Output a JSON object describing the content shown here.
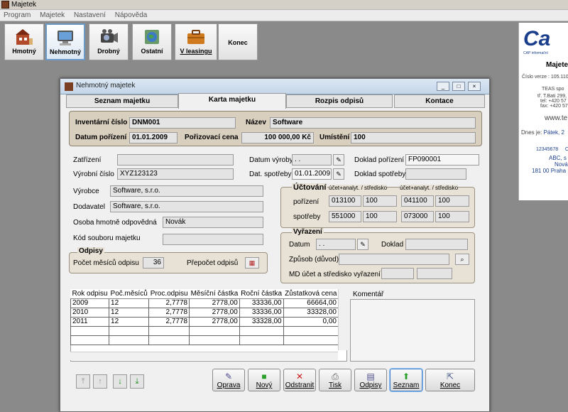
{
  "app": {
    "title": "Majetek"
  },
  "menu": [
    "Program",
    "Majetek",
    "Nastavení",
    "Nápověda"
  ],
  "toolbar": {
    "buttons": [
      {
        "label": "Hmotný",
        "icon": "building-icon"
      },
      {
        "label": "Nehmotný",
        "icon": "monitor-icon"
      },
      {
        "label": "Drobný",
        "icon": "camera-icon"
      },
      {
        "label": "Ostatní",
        "icon": "globe-icon"
      },
      {
        "label": "V leasingu",
        "icon": "briefcase-icon"
      },
      {
        "label": "Konec",
        "icon": ""
      }
    ]
  },
  "sidepanel": {
    "logo": "Ca",
    "logo_sub": "CAP informační",
    "title": "Majetek",
    "version": "Číslo verze : 105.110",
    "company": "TEAS spo",
    "address": "tř. T.Bati 299,",
    "tel": "tel: +420 57",
    "fax": "fax: +420 57",
    "web": "www.te",
    "date_label": "Dnes je:",
    "date_value": "Pátek, 2",
    "id": "12345678",
    "id2": "C",
    "client1": "ABC, s",
    "client2": "Nová",
    "client3": "181 00  Praha"
  },
  "dialog": {
    "title": "Nehmotný majetek",
    "tabs": [
      "Seznam majetku",
      "Karta majetku",
      "Rozpis odpisů",
      "Kontace"
    ],
    "header": {
      "inv_label": "Inventární číslo",
      "inv_value": "DNM001",
      "name_label": "Název",
      "name_value": "Software",
      "date_label": "Datum pořízení",
      "date_value": "01.01.2009",
      "price_label": "Pořizovací cena",
      "price_value": "100 000,00 Kč",
      "loc_label": "Umístění",
      "loc_value": "100"
    },
    "fields": {
      "zatrizeni_label": "Zatřízení",
      "zatrizeni_value": "",
      "vyrobni_label": "Výrobní číslo",
      "vyrobni_value": "XYZ123123",
      "datum_vyroby_label": "Datum výroby",
      "datum_vyroby_value": " .  .",
      "dat_spotreby_label": "Dat. spotřeby",
      "dat_spotreby_value": "01.01.2009",
      "doklad_porizeni_label": "Doklad pořízení",
      "doklad_porizeni_value": "FP090001",
      "doklad_spotreby_label": "Doklad spotřeby",
      "doklad_spotreby_value": "",
      "vyrobce_label": "Výrobce",
      "vyrobce_value": "Software, s.r.o.",
      "dodavatel_label": "Dodavatel",
      "dodavatel_value": "Software, s.r.o.",
      "osoba_label": "Osoba hmotně odpovědná",
      "osoba_value": "Novák",
      "kod_label": "Kód souboru majetku",
      "kod_value": ""
    },
    "uctovani": {
      "title": "Účtování",
      "col1": "účet+analyt. / středisko",
      "col2": "účet+analyt. / středisko",
      "porizeni_label": "pořízení",
      "porizeni": [
        "013100",
        "100",
        "041100",
        "100"
      ],
      "spotreby_label": "spotřeby",
      "spotreby": [
        "551000",
        "100",
        "073000",
        "100"
      ]
    },
    "vyrazeni": {
      "title": "Vyřazení",
      "datum_label": "Datum",
      "datum_value": " .  .",
      "doklad_label": "Doklad",
      "doklad_value": "",
      "zpusob_label": "Způsob (důvod)",
      "zpusob_value": "",
      "md_label": "MD účet  a středisko vyřazení"
    },
    "odpisy": {
      "title": "Odpisy",
      "pocet_label": "Počet měsíců odpisu",
      "pocet_value": "36",
      "prepocet_label": "Přepočet odpisů"
    },
    "table": {
      "columns": [
        "Rok odpisu",
        "Poč.měsíců",
        "Proc.odpisu",
        "Měsíční částka",
        "Roční částka",
        "Zůstatková cena"
      ],
      "rows": [
        [
          "2009",
          "12",
          "2,7778",
          "2778,00",
          "33336,00",
          "66664,00"
        ],
        [
          "2010",
          "12",
          "2,7778",
          "2778,00",
          "33336,00",
          "33328,00"
        ],
        [
          "2011",
          "12",
          "2,7778",
          "2778,00",
          "33328,00",
          "0,00"
        ]
      ]
    },
    "komentar_label": "Komentář",
    "buttons": [
      "Oprava",
      "Nový",
      "Odstranit",
      "Tisk",
      "Odpisy",
      "Seznam",
      "Konec"
    ]
  }
}
